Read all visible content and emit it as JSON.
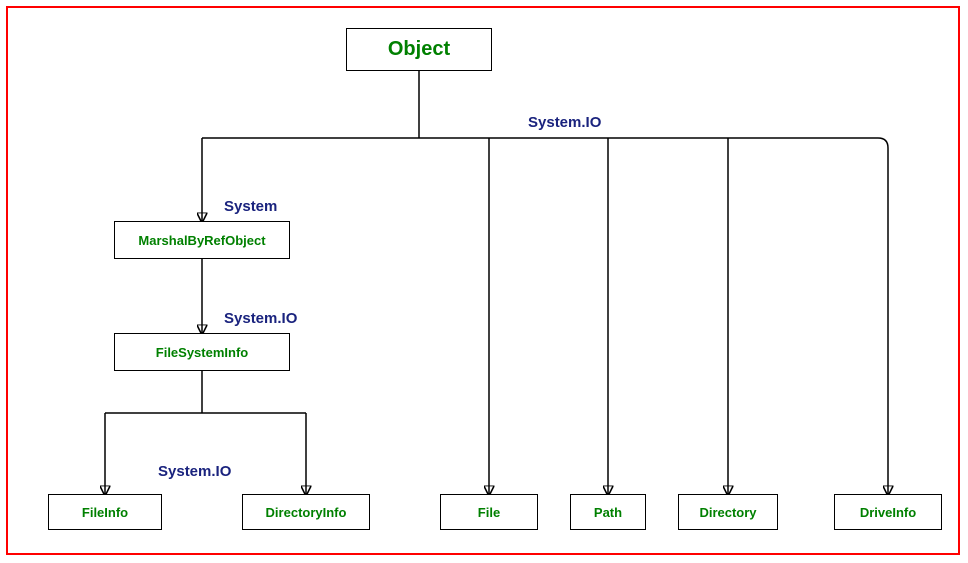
{
  "root": {
    "label": "Object"
  },
  "ns_top": "System.IO",
  "ns_system": "System",
  "ns_fsinfo": "System.IO",
  "ns_bottom": "System.IO",
  "marshal": {
    "label": "MarshalByRefObject"
  },
  "fsinfo": {
    "label": "FileSystemInfo"
  },
  "fileinfo": {
    "label": "FileInfo"
  },
  "dirinfo": {
    "label": "DirectoryInfo"
  },
  "file": {
    "label": "File"
  },
  "path": {
    "label": "Path"
  },
  "directory": {
    "label": "Directory"
  },
  "driveinfo": {
    "label": "DriveInfo"
  }
}
